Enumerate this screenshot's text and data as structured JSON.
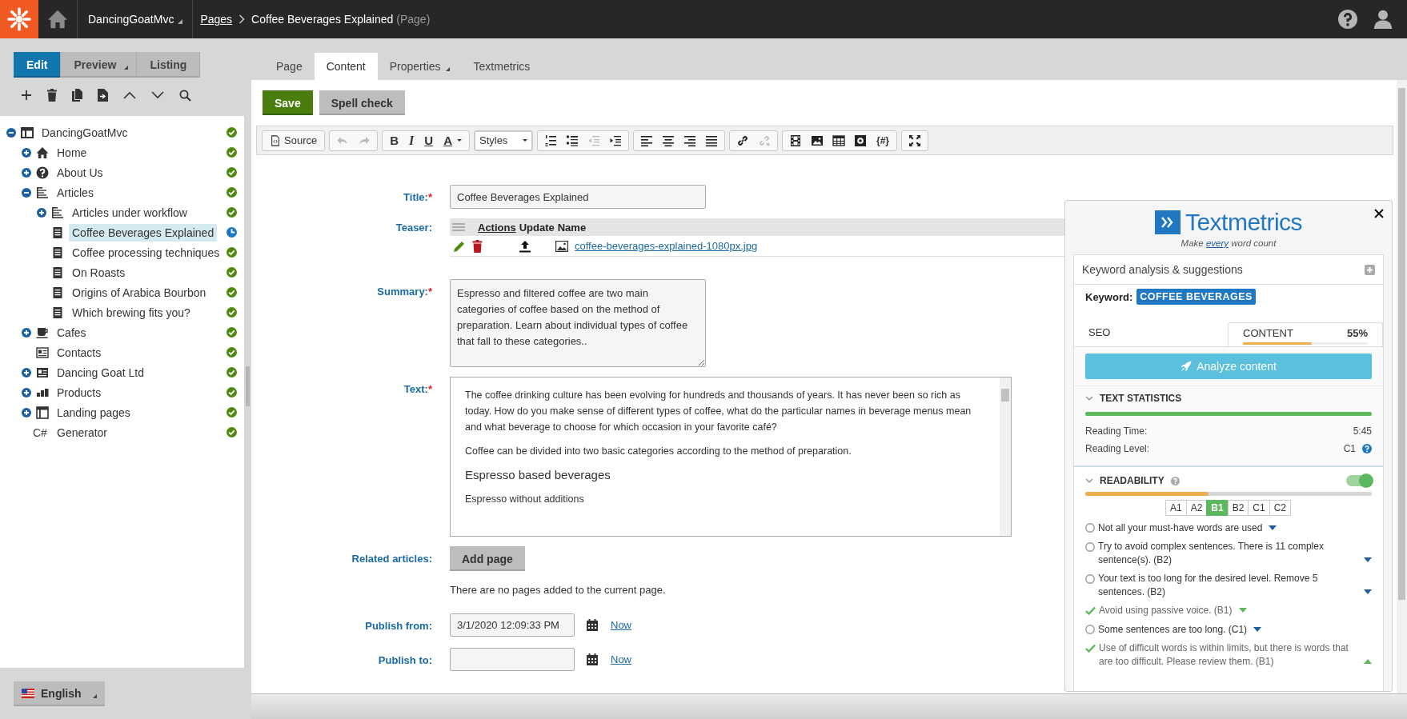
{
  "top_bar": {
    "site": "DancingGoatMvc",
    "breadcrumb_link": "Pages",
    "current_page": "Coffee Beverages Explained",
    "page_type": "(Page)"
  },
  "mode_buttons": [
    {
      "label": "Edit",
      "selected": true,
      "dropdown": false
    },
    {
      "label": "Preview",
      "selected": false,
      "dropdown": true
    },
    {
      "label": "Listing",
      "selected": false,
      "dropdown": false
    }
  ],
  "tree": [
    {
      "label": "DancingGoatMvc",
      "kind": "site",
      "scheduled": false,
      "selected": false,
      "expanded": true,
      "children": [
        {
          "label": "Home",
          "kind": "home",
          "scheduled": false,
          "selected": false,
          "expanded": false
        },
        {
          "label": "About Us",
          "kind": "about",
          "scheduled": false,
          "selected": false,
          "expanded": false
        },
        {
          "label": "Articles",
          "kind": "folder",
          "scheduled": false,
          "selected": false,
          "expanded": true,
          "children": [
            {
              "label": "Articles under workflow",
              "kind": "folder",
              "scheduled": false,
              "selected": false,
              "expanded": false
            },
            {
              "label": "Coffee Beverages Explained",
              "kind": "page",
              "scheduled": true,
              "selected": true
            },
            {
              "label": "Coffee processing techniques",
              "kind": "page",
              "scheduled": false,
              "selected": false
            },
            {
              "label": "On Roasts",
              "kind": "page",
              "scheduled": false,
              "selected": false
            },
            {
              "label": "Origins of Arabica Bourbon",
              "kind": "page",
              "scheduled": false,
              "selected": false
            },
            {
              "label": "Which brewing fits you?",
              "kind": "page",
              "scheduled": false,
              "selected": false
            }
          ]
        },
        {
          "label": "Cafes",
          "kind": "cafe",
          "scheduled": false,
          "selected": false,
          "expanded": false
        },
        {
          "label": "Contacts",
          "kind": "contacts",
          "scheduled": false,
          "selected": false
        },
        {
          "label": "Dancing Goat Ltd",
          "kind": "company",
          "scheduled": false,
          "selected": false,
          "expanded": false
        },
        {
          "label": "Products",
          "kind": "products",
          "scheduled": false,
          "selected": false,
          "expanded": false
        },
        {
          "label": "Landing pages",
          "kind": "landing",
          "scheduled": false,
          "selected": false,
          "expanded": false
        },
        {
          "label": "Generator",
          "kind": "code",
          "icon_text": "C#",
          "scheduled": false,
          "selected": false
        }
      ]
    }
  ],
  "language": {
    "label": "English"
  },
  "tabs": [
    {
      "label": "Page",
      "selected": false,
      "dropdown": false
    },
    {
      "label": "Content",
      "selected": true,
      "dropdown": false
    },
    {
      "label": "Properties",
      "selected": false,
      "dropdown": true
    },
    {
      "label": "Textmetrics",
      "selected": false,
      "dropdown": false
    }
  ],
  "actions": [
    {
      "label": "Save",
      "kind": "primary"
    },
    {
      "label": "Spell check",
      "kind": "secondary"
    }
  ],
  "editor_toolbar": [
    [
      {
        "kind": "source",
        "label": "Source",
        "disabled": false
      }
    ],
    [
      {
        "kind": "undo",
        "disabled": true
      },
      {
        "kind": "redo",
        "disabled": true
      }
    ],
    [
      {
        "kind": "bold",
        "label": "B",
        "disabled": false
      },
      {
        "kind": "italic",
        "label": "I",
        "disabled": false
      },
      {
        "kind": "underline",
        "label": "U",
        "disabled": false
      },
      {
        "kind": "color",
        "label": "A",
        "disabled": false
      }
    ],
    [
      {
        "kind": "styles",
        "label": "Styles",
        "disabled": false
      }
    ],
    [
      {
        "kind": "ordered-list",
        "disabled": false
      },
      {
        "kind": "bullet-list",
        "disabled": false
      },
      {
        "kind": "outdent",
        "disabled": true
      },
      {
        "kind": "indent",
        "disabled": false
      }
    ],
    [
      {
        "kind": "align-left",
        "disabled": false
      },
      {
        "kind": "align-center",
        "disabled": false
      },
      {
        "kind": "align-right",
        "disabled": false
      },
      {
        "kind": "justify",
        "disabled": false
      }
    ],
    [
      {
        "kind": "link",
        "disabled": false
      },
      {
        "kind": "unlink",
        "disabled": true
      }
    ],
    [
      {
        "kind": "media",
        "disabled": false
      },
      {
        "kind": "image",
        "disabled": false
      },
      {
        "kind": "table",
        "disabled": false
      },
      {
        "kind": "widget",
        "disabled": false
      },
      {
        "kind": "macro",
        "label": "{#}",
        "disabled": false
      }
    ],
    [
      {
        "kind": "maximize",
        "disabled": false
      }
    ]
  ],
  "form": {
    "title": {
      "label": "Title:",
      "required_mark": "*",
      "value": "Coffee Beverages Explained"
    },
    "teaser": {
      "label": "Teaser:",
      "columns": [
        "Actions",
        "Update",
        "Name"
      ],
      "file": "coffee-beverages-explained-1080px.jpg"
    },
    "summary": {
      "label": "Summary:",
      "required_mark": "*",
      "value": "Espresso and filtered coffee are two main categories of coffee based on the method of preparation. Learn about individual types of coffee that fall to these categories.."
    },
    "text": {
      "label": "Text:",
      "required_mark": "*",
      "blocks": [
        {
          "kind": "paragraph",
          "text": "The coffee drinking culture has been evolving for hundreds and thousands of years. It has never been so rich as today. How do you make sense of different types of coffee, what do the particular names in beverage menus mean and what beverage to choose for which occasion in your favorite café?"
        },
        {
          "kind": "paragraph",
          "text": "Coffee can be divided into two basic categories according to the method of preparation."
        },
        {
          "kind": "heading",
          "text": "Espresso based beverages"
        },
        {
          "kind": "paragraph",
          "text": "Espresso without additions"
        }
      ]
    },
    "related": {
      "label": "Related articles:",
      "button": "Add page",
      "note": "There are no pages added to the current page."
    },
    "publish_from": {
      "label": "Publish from:",
      "value": "3/1/2020 12:09:33 PM",
      "link": "Now"
    },
    "publish_to": {
      "label": "Publish to:",
      "link": "Now"
    }
  },
  "textmetrics": {
    "brand": "Textmetrics",
    "tagline": {
      "before": "Make",
      "link": "every",
      "after": "word count"
    },
    "section": "Keyword analysis & suggestions",
    "keyword_label": "Keyword:",
    "keyword": "COFFEE BEVERAGES",
    "tabs": [
      {
        "label": "SEO",
        "selected": false
      },
      {
        "label": "CONTENT",
        "selected": true,
        "score": "55%",
        "level": 0.55
      }
    ],
    "analyze_button": "Analyze content",
    "text_statistics": {
      "title": "TEXT STATISTICS",
      "level": 1,
      "rows": [
        {
          "label": "Reading Time:",
          "value": "5:45",
          "help": false
        },
        {
          "label": "Reading Level:",
          "value": "C1",
          "help": true
        }
      ]
    },
    "readability": {
      "title": "READABILITY",
      "on": true,
      "level": 0.43,
      "levels": [
        {
          "label": "A1",
          "selected": false
        },
        {
          "label": "A2",
          "selected": false
        },
        {
          "label": "B1",
          "selected": true
        },
        {
          "label": "B2",
          "selected": false
        },
        {
          "label": "C1",
          "selected": false
        },
        {
          "label": "C2",
          "selected": false
        }
      ],
      "items": [
        {
          "text": "Not all your must-have words are used",
          "passed": false,
          "expanded": false
        },
        {
          "text": "Try to avoid complex sentences. There is 11 complex sentence(s). (B2)",
          "passed": false,
          "expanded": false
        },
        {
          "text": "Your text is too long for the desired level. Remove 5 sentences. (B2)",
          "passed": false,
          "expanded": false
        },
        {
          "text": "Avoid using passive voice. (B1)",
          "passed": true,
          "expanded": false
        },
        {
          "text": "Some sentences are too long. (C1)",
          "passed": false,
          "expanded": false
        },
        {
          "text": "Use of difficult words is within limits, but there is words that are too difficult. Please review them. (B1)",
          "passed": true,
          "expanded": true
        }
      ]
    }
  }
}
